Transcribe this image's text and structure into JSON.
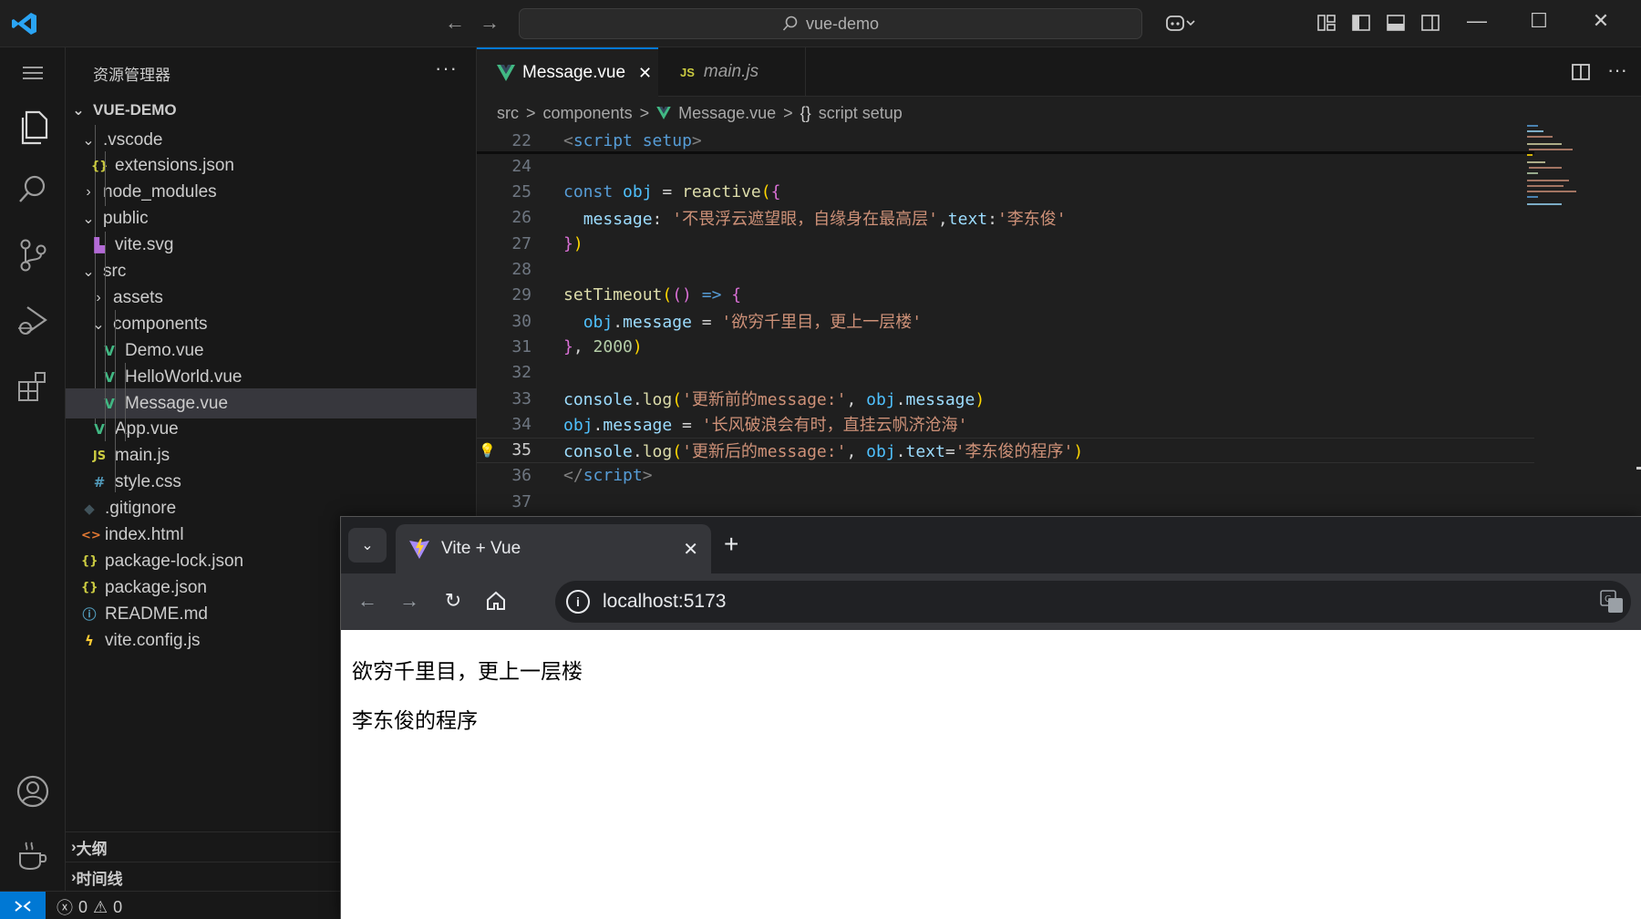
{
  "titlebar": {
    "search_text": "vue-demo"
  },
  "explorer": {
    "title": "资源管理器",
    "more": "···",
    "root": "VUE-DEMO",
    "items": [
      {
        "label": ".vscode",
        "type": "folder-open"
      },
      {
        "label": "extensions.json",
        "type": "json"
      },
      {
        "label": "node_modules",
        "type": "folder-closed"
      },
      {
        "label": "public",
        "type": "folder-open"
      },
      {
        "label": "vite.svg",
        "type": "svg"
      },
      {
        "label": "src",
        "type": "folder-open"
      },
      {
        "label": "assets",
        "type": "folder-closed"
      },
      {
        "label": "components",
        "type": "folder-open"
      },
      {
        "label": "Demo.vue",
        "type": "vue"
      },
      {
        "label": "HelloWorld.vue",
        "type": "vue"
      },
      {
        "label": "Message.vue",
        "type": "vue"
      },
      {
        "label": "App.vue",
        "type": "vue"
      },
      {
        "label": "main.js",
        "type": "js"
      },
      {
        "label": "style.css",
        "type": "css"
      },
      {
        "label": ".gitignore",
        "type": "git"
      },
      {
        "label": "index.html",
        "type": "html"
      },
      {
        "label": "package-lock.json",
        "type": "json"
      },
      {
        "label": "package.json",
        "type": "json"
      },
      {
        "label": "README.md",
        "type": "info"
      },
      {
        "label": "vite.config.js",
        "type": "vite"
      }
    ],
    "outline_label": "大纲",
    "timeline_label": "时间线"
  },
  "editor": {
    "tabs": [
      {
        "label": "Message.vue",
        "active": true
      },
      {
        "label": "main.js",
        "active": false
      }
    ],
    "breadcrumb": [
      "src",
      "components",
      "Message.vue",
      "script setup"
    ],
    "breadcrumb_sep": ">",
    "code_lines": [
      {
        "n": "22",
        "tokens": [
          [
            "tag-open",
            "<"
          ],
          [
            "tag",
            "script"
          ],
          [
            "text",
            " "
          ],
          [
            "attr",
            "setup"
          ],
          [
            "tag-open",
            ">"
          ]
        ]
      },
      {
        "n": "24",
        "tokens": []
      },
      {
        "n": "25",
        "tokens": [
          [
            "kw",
            "const"
          ],
          [
            "text",
            " "
          ],
          [
            "var",
            "obj"
          ],
          [
            "op",
            " = "
          ],
          [
            "fn",
            "reactive"
          ],
          [
            "br1",
            "("
          ],
          [
            "br2",
            "{"
          ]
        ]
      },
      {
        "n": "26",
        "tokens": [
          [
            "text",
            "  "
          ],
          [
            "prop",
            "message"
          ],
          [
            "op",
            ": "
          ],
          [
            "str",
            "'不畏浮云遮望眼，自缘身在最高层'"
          ],
          [
            "op",
            ","
          ],
          [
            "prop",
            "text"
          ],
          [
            "op",
            ":"
          ],
          [
            "str",
            "'李东俊'"
          ]
        ]
      },
      {
        "n": "27",
        "tokens": [
          [
            "br2",
            "}"
          ],
          [
            "br1",
            ")"
          ]
        ]
      },
      {
        "n": "28",
        "tokens": []
      },
      {
        "n": "29",
        "tokens": [
          [
            "fn",
            "setTimeout"
          ],
          [
            "br1",
            "("
          ],
          [
            "br2",
            "()"
          ],
          [
            "op",
            " "
          ],
          [
            "kw",
            "=>"
          ],
          [
            "op",
            " "
          ],
          [
            "br2",
            "{"
          ]
        ]
      },
      {
        "n": "30",
        "tokens": [
          [
            "text",
            "  "
          ],
          [
            "var",
            "obj"
          ],
          [
            "op",
            "."
          ],
          [
            "prop",
            "message"
          ],
          [
            "op",
            " = "
          ],
          [
            "str",
            "'欲穷千里目，更上一层楼'"
          ]
        ]
      },
      {
        "n": "31",
        "tokens": [
          [
            "br2",
            "}"
          ],
          [
            "op",
            ", "
          ],
          [
            "num",
            "2000"
          ],
          [
            "br1",
            ")"
          ]
        ]
      },
      {
        "n": "32",
        "tokens": []
      },
      {
        "n": "33",
        "tokens": [
          [
            "prop",
            "console"
          ],
          [
            "op",
            "."
          ],
          [
            "fn",
            "log"
          ],
          [
            "br1",
            "("
          ],
          [
            "str",
            "'更新前的message:'"
          ],
          [
            "op",
            ", "
          ],
          [
            "var",
            "obj"
          ],
          [
            "op",
            "."
          ],
          [
            "prop",
            "message"
          ],
          [
            "br1",
            ")"
          ]
        ]
      },
      {
        "n": "34",
        "tokens": [
          [
            "var",
            "obj"
          ],
          [
            "op",
            "."
          ],
          [
            "prop",
            "message"
          ],
          [
            "op",
            " = "
          ],
          [
            "str",
            "'长风破浪会有时，直挂云帆济沧海'"
          ]
        ]
      },
      {
        "n": "35",
        "tokens": [
          [
            "prop",
            "console"
          ],
          [
            "op",
            "."
          ],
          [
            "fn",
            "log"
          ],
          [
            "br1",
            "("
          ],
          [
            "str",
            "'更新后的message:'"
          ],
          [
            "op",
            ", "
          ],
          [
            "var",
            "obj"
          ],
          [
            "op",
            "."
          ],
          [
            "prop",
            "text"
          ],
          [
            "op",
            "="
          ],
          [
            "str",
            "'李东俊的程序'"
          ],
          [
            "br1",
            ")"
          ]
        ]
      },
      {
        "n": "36",
        "tokens": [
          [
            "tag-open",
            "</"
          ],
          [
            "tag",
            "script"
          ],
          [
            "tag-open",
            ">"
          ]
        ]
      },
      {
        "n": "37",
        "tokens": []
      }
    ],
    "current_line": "35"
  },
  "statusbar": {
    "errors": "0",
    "warnings": "0"
  },
  "browser": {
    "tab_title": "Vite + Vue",
    "url": "localhost:5173",
    "content": [
      "欲穷千里目，更上一层楼",
      "李东俊的程序"
    ]
  },
  "colors": {
    "vscode_bg": "#1f1f1f",
    "accent": "#0078d4",
    "vue_green": "#41b883",
    "js_yellow": "#cbcb41"
  }
}
